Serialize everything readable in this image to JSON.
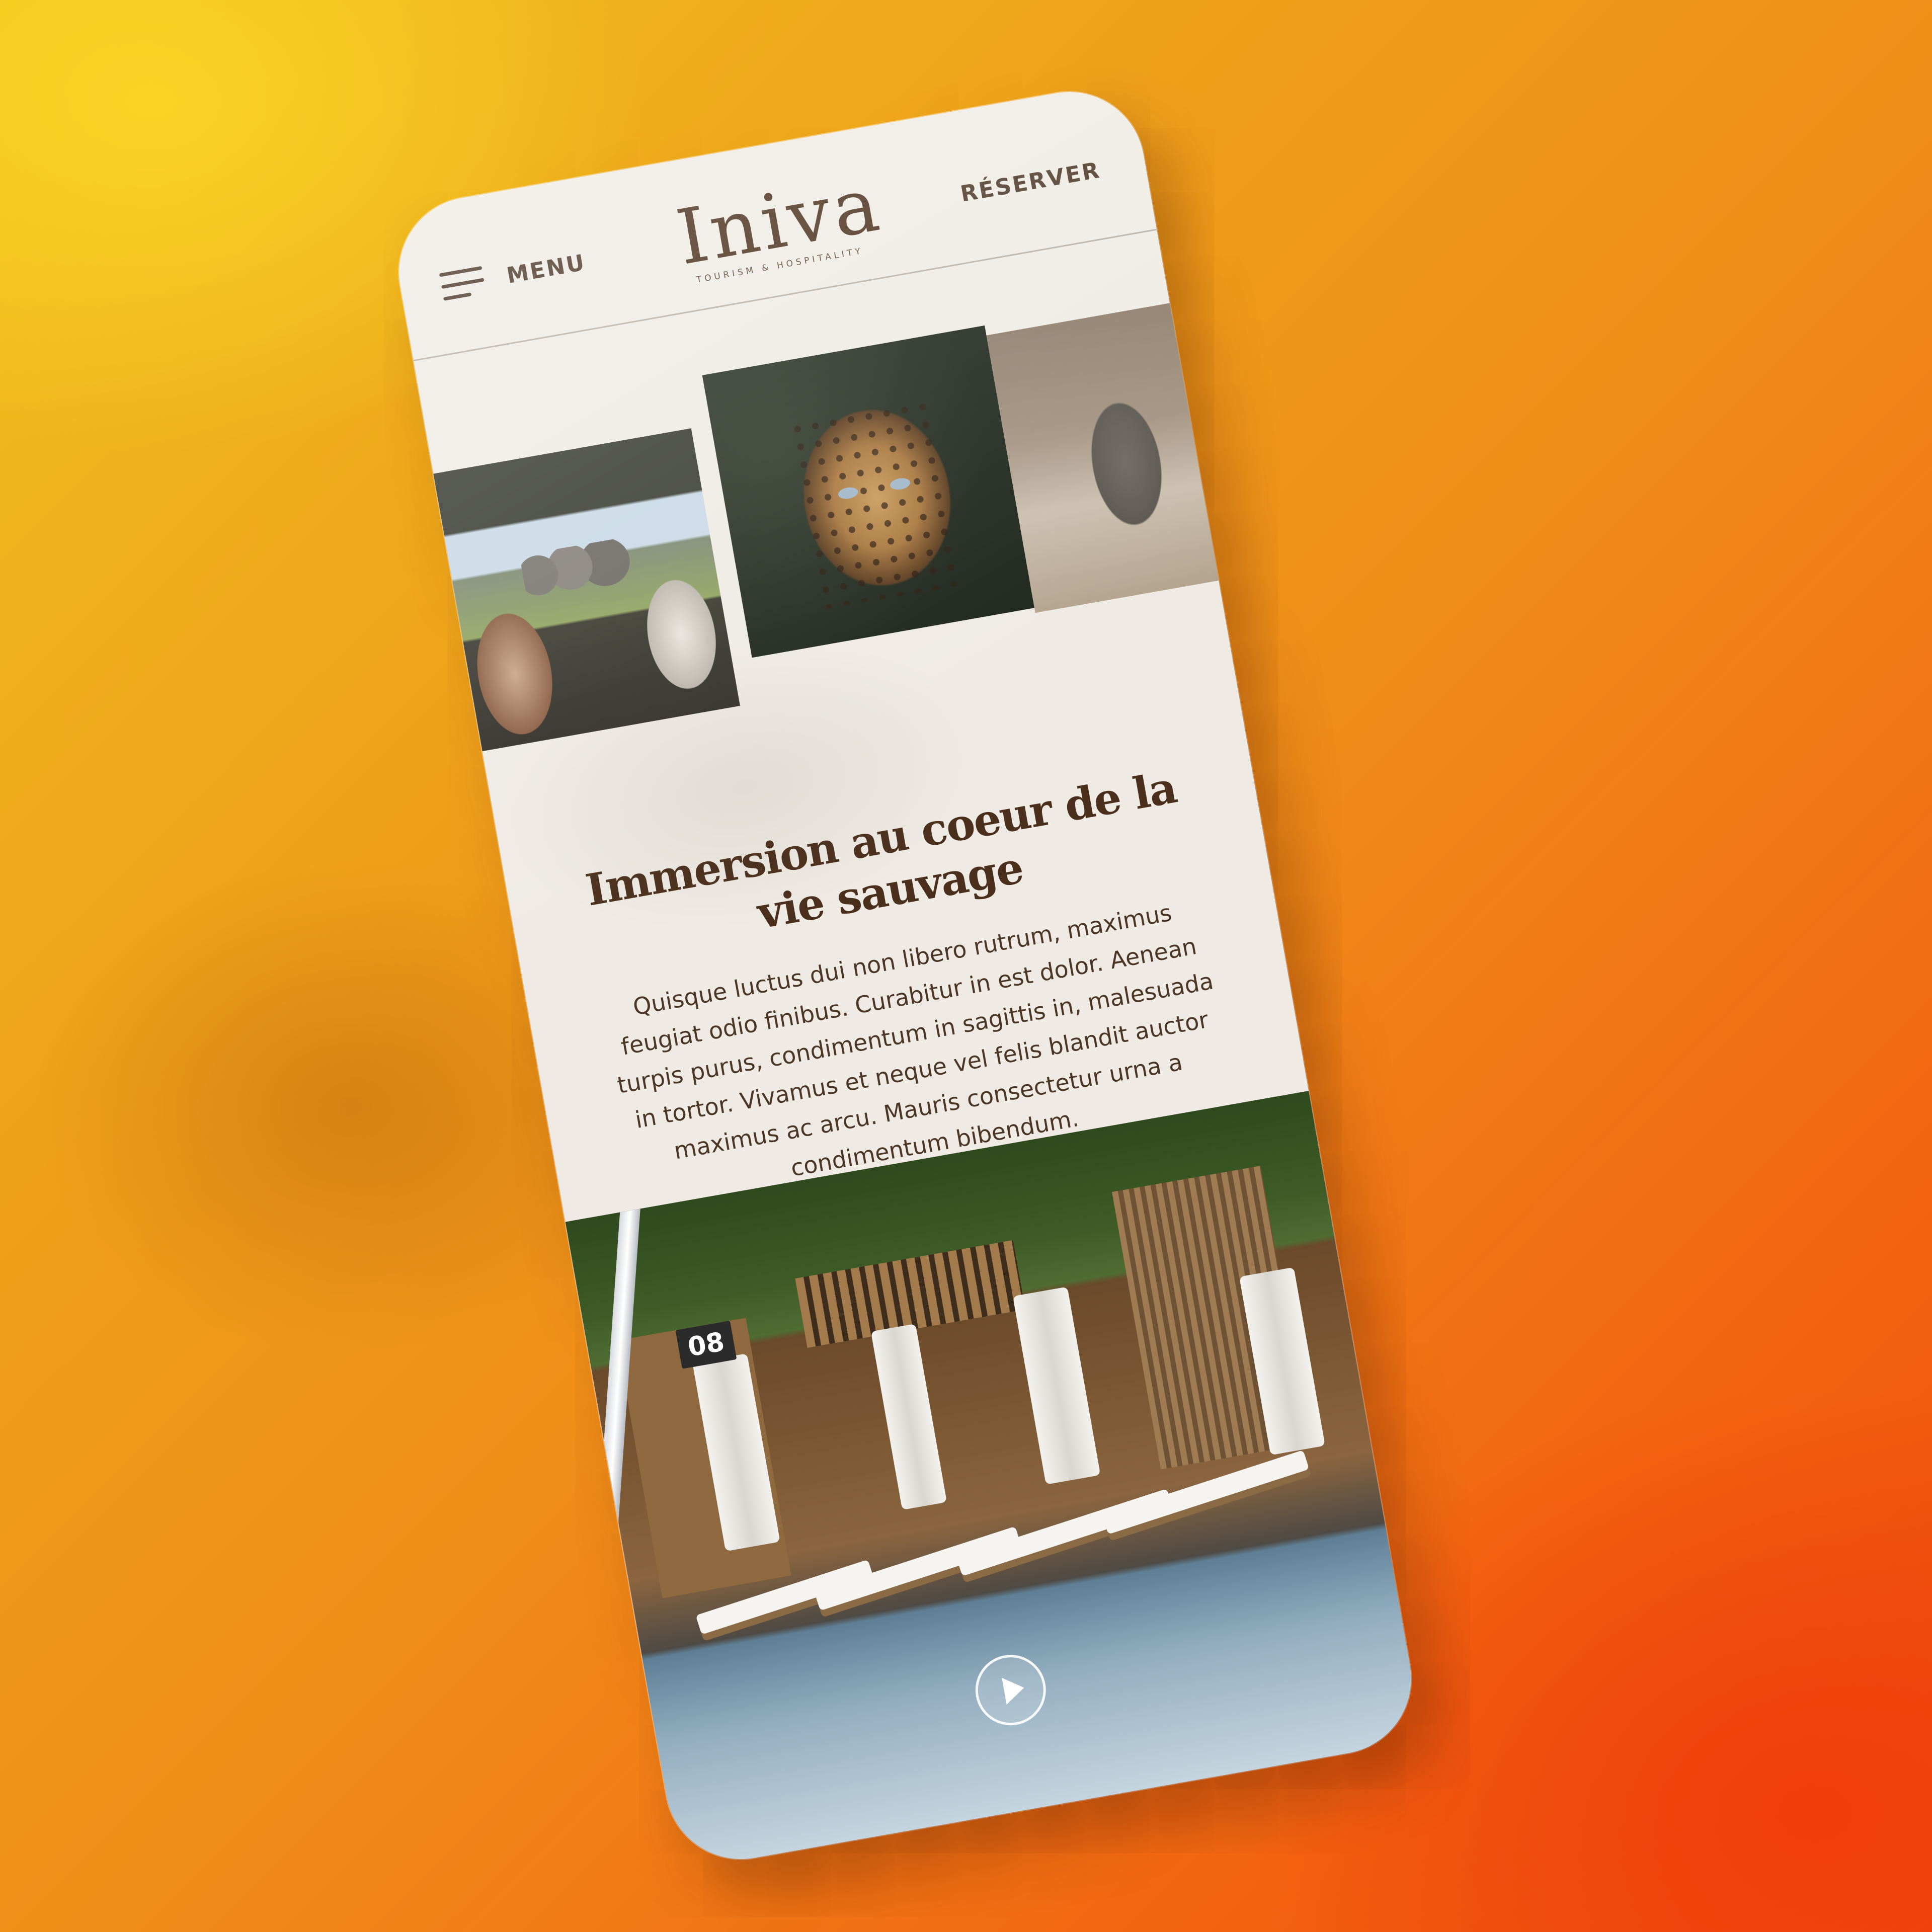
{
  "header": {
    "menu_label": "MENU",
    "logo_text": "Iniva",
    "logo_tagline": "TOURISM & HOSPITALITY",
    "reserve_label": "RÉSERVER"
  },
  "gallery": [
    {
      "subject": "safari-vehicle-elephants"
    },
    {
      "subject": "leopard"
    },
    {
      "subject": "elephant"
    }
  ],
  "section": {
    "title": "Immersion au coeur de la vie sauvage",
    "body": "Quisque luctus dui non libero rutrum, maximus feugiat odio finibus. Curabitur in est dolor. Aenean turpis purus, condimentum in sagittis in, malesuada in tortor. Vivamus et neque vel felis blandit auctor maximus ac arcu. Mauris consectetur urna a condimentum bibendum."
  },
  "video": {
    "cabana_number": "08",
    "icon": "play-icon"
  },
  "colors": {
    "brand_brown": "#4a2f1c",
    "page_bg": "#efebe4",
    "background_gradient_start": "#f2c21c",
    "background_gradient_end": "#ef4a0c"
  }
}
